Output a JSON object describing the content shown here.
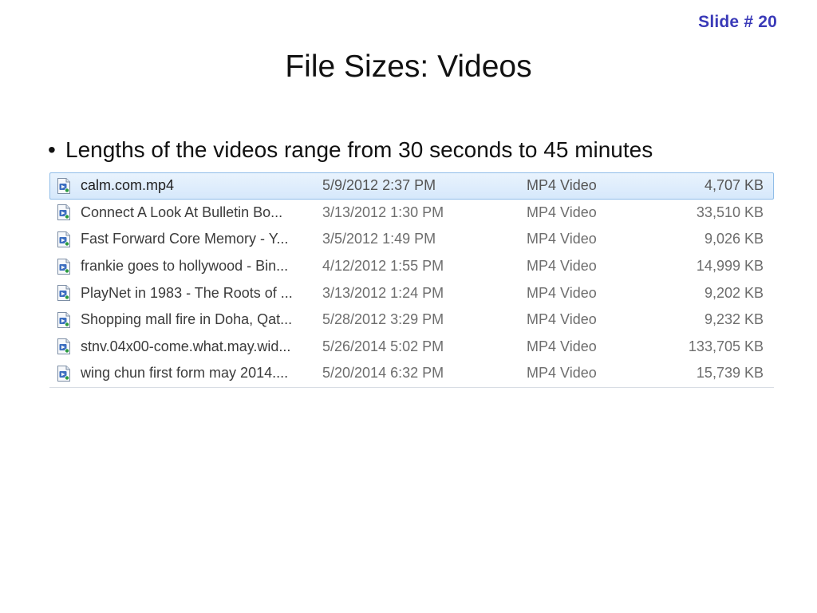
{
  "slide_number": "Slide # 20",
  "title": "File Sizes: Videos",
  "bullet": {
    "marker": "•",
    "text": "Lengths of the videos range from 30 seconds to 45 minutes"
  },
  "file_icon": "video-file-icon",
  "selection_color": "#d6e8fb",
  "files": [
    {
      "name": "calm.com.mp4",
      "date": "5/9/2012 2:37 PM",
      "type": "MP4 Video",
      "size": "4,707 KB",
      "selected": true
    },
    {
      "name": "Connect  A Look At Bulletin Bo...",
      "date": "3/13/2012 1:30 PM",
      "type": "MP4 Video",
      "size": "33,510 KB",
      "selected": false
    },
    {
      "name": "Fast Forward Core Memory - Y...",
      "date": "3/5/2012 1:49 PM",
      "type": "MP4 Video",
      "size": "9,026 KB",
      "selected": false
    },
    {
      "name": "frankie goes to hollywood - Bin...",
      "date": "4/12/2012 1:55 PM",
      "type": "MP4 Video",
      "size": "14,999 KB",
      "selected": false
    },
    {
      "name": "PlayNet  in 1983 - The Roots of ...",
      "date": "3/13/2012 1:24 PM",
      "type": "MP4 Video",
      "size": "9,202 KB",
      "selected": false
    },
    {
      "name": "Shopping mall fire in Doha, Qat...",
      "date": "5/28/2012 3:29 PM",
      "type": "MP4 Video",
      "size": "9,232 KB",
      "selected": false
    },
    {
      "name": "stnv.04x00-come.what.may.wid...",
      "date": "5/26/2014 5:02 PM",
      "type": "MP4 Video",
      "size": "133,705 KB",
      "selected": false
    },
    {
      "name": "wing chun first form may 2014....",
      "date": "5/20/2014 6:32 PM",
      "type": "MP4 Video",
      "size": "15,739 KB",
      "selected": false
    }
  ]
}
